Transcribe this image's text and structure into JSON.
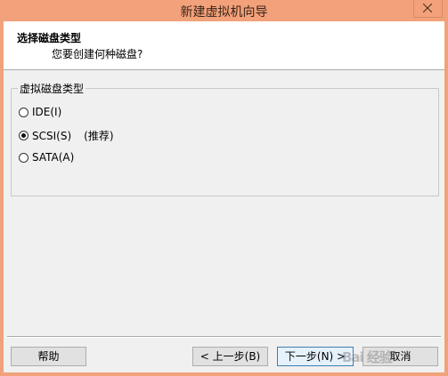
{
  "window": {
    "title": "新建虚拟机向导"
  },
  "header": {
    "title": "选择磁盘类型",
    "subtitle": "您要创建何种磁盘?"
  },
  "group": {
    "legend": "虚拟磁盘类型",
    "options": [
      {
        "label": "IDE(I)",
        "checked": false
      },
      {
        "label": "SCSI(S)",
        "checked": true,
        "note": "(推荐)"
      },
      {
        "label": "SATA(A)",
        "checked": false
      }
    ]
  },
  "buttons": {
    "help": "帮助",
    "back": "< 上一步(B)",
    "next": "下一步(N) >",
    "cancel": "取消"
  },
  "watermark": "Bai 经验"
}
